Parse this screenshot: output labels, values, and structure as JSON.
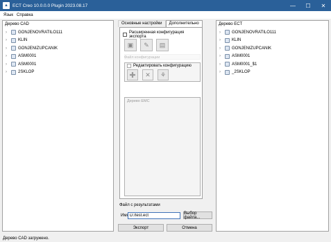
{
  "window": {
    "title": "ECT Creo 10.0.0.0 Plugin 2023.08.17",
    "controls": {
      "minimize": "—",
      "maximize": "☐",
      "close": "✕"
    }
  },
  "menu": {
    "items": [
      "Язык",
      "Справка"
    ]
  },
  "left_panel": {
    "header": "Дерево CAD",
    "items": [
      "GONJENOVRATILO111",
      "KLIN",
      "GONJENIZUPCANIK",
      "ASM0001",
      "ASM0001",
      "2SKLOP"
    ]
  },
  "tabs": [
    {
      "label": "Основные настройки",
      "active": false
    },
    {
      "label": "Дополнительно",
      "active": true
    }
  ],
  "advanced": {
    "extended_config_label": "Расширенная конфигурация экспорта",
    "config_file_label": "Файл конфигурации",
    "edit_config_label": "Редактировать конфигурацию",
    "emc_tree_label": "Дерево EMC"
  },
  "result": {
    "label": "Файл с результатами",
    "name_label": "Имя",
    "name_value": "D:/test.ect",
    "choose_button": "Выбор файла..."
  },
  "buttons": {
    "export": "Экспорт",
    "cancel": "Отмена"
  },
  "right_panel": {
    "header": "Дерево ECT",
    "items": [
      "GONJENOVRATILO111",
      "KLIN",
      "GONJENIZUPCANIK",
      "ASM0001",
      "ASM0001_$1",
      "_2SKLOP"
    ]
  },
  "status": "Дерево CAD загружено.",
  "colors": {
    "titlebar": "#2a6099",
    "input_focus_border": "#3f72b8"
  }
}
